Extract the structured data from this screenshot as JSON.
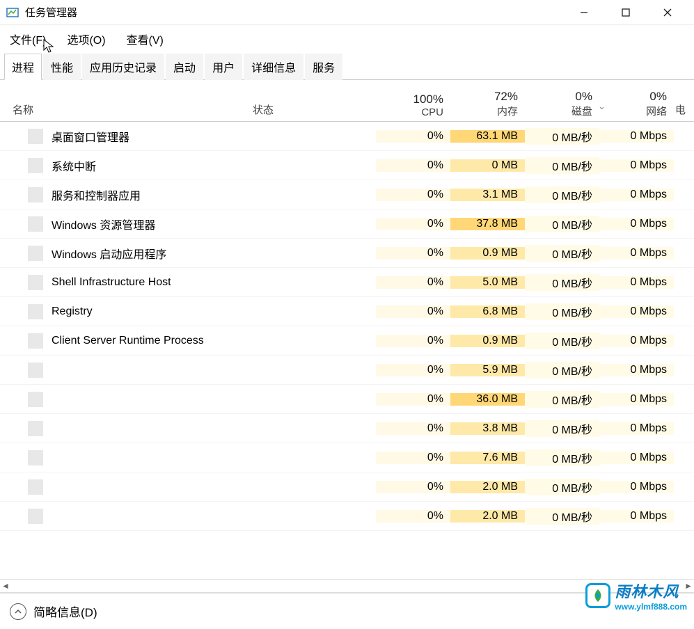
{
  "window": {
    "title": "任务管理器"
  },
  "menu": {
    "file": "文件(F)",
    "options": "选项(O)",
    "view": "查看(V)"
  },
  "tabs": {
    "processes": "进程",
    "performance": "性能",
    "appHistory": "应用历史记录",
    "startup": "启动",
    "users": "用户",
    "details": "详细信息",
    "services": "服务"
  },
  "columns": {
    "name": "名称",
    "status": "状态",
    "cpu_pct": "100%",
    "cpu_label": "CPU",
    "mem_pct": "72%",
    "mem_label": "内存",
    "disk_pct": "0%",
    "disk_label": "磁盘",
    "net_pct": "0%",
    "net_label": "网络",
    "edge_label": "电"
  },
  "processes": [
    {
      "name": "桌面窗口管理器",
      "cpu": "0%",
      "mem": "63.1 MB",
      "mem_heat": "heat-mem1",
      "disk": "0 MB/秒",
      "net": "0 Mbps"
    },
    {
      "name": "系统中断",
      "cpu": "0%",
      "mem": "0 MB",
      "mem_heat": "heat-mem2",
      "disk": "0 MB/秒",
      "net": "0 Mbps"
    },
    {
      "name": "服务和控制器应用",
      "cpu": "0%",
      "mem": "3.1 MB",
      "mem_heat": "heat-mem0",
      "disk": "0 MB/秒",
      "net": "0 Mbps"
    },
    {
      "name": "Windows 资源管理器",
      "cpu": "0%",
      "mem": "37.8 MB",
      "mem_heat": "heat-mem1",
      "disk": "0 MB/秒",
      "net": "0 Mbps"
    },
    {
      "name": "Windows 启动应用程序",
      "cpu": "0%",
      "mem": "0.9 MB",
      "mem_heat": "heat-mem0",
      "disk": "0 MB/秒",
      "net": "0 Mbps"
    },
    {
      "name": "Shell Infrastructure Host",
      "cpu": "0%",
      "mem": "5.0 MB",
      "mem_heat": "heat-mem0",
      "disk": "0 MB/秒",
      "net": "0 Mbps"
    },
    {
      "name": "Registry",
      "cpu": "0%",
      "mem": "6.8 MB",
      "mem_heat": "heat-mem0",
      "disk": "0 MB/秒",
      "net": "0 Mbps"
    },
    {
      "name": "Client Server Runtime Process",
      "cpu": "0%",
      "mem": "0.9 MB",
      "mem_heat": "heat-mem0",
      "disk": "0 MB/秒",
      "net": "0 Mbps"
    },
    {
      "name": "",
      "cpu": "0%",
      "mem": "5.9 MB",
      "mem_heat": "heat-mem0",
      "disk": "0 MB/秒",
      "net": "0 Mbps"
    },
    {
      "name": "",
      "cpu": "0%",
      "mem": "36.0 MB",
      "mem_heat": "heat-mem1",
      "disk": "0 MB/秒",
      "net": "0 Mbps"
    },
    {
      "name": "",
      "cpu": "0%",
      "mem": "3.8 MB",
      "mem_heat": "heat-mem0",
      "disk": "0 MB/秒",
      "net": "0 Mbps"
    },
    {
      "name": "",
      "cpu": "0%",
      "mem": "7.6 MB",
      "mem_heat": "heat-mem0",
      "disk": "0 MB/秒",
      "net": "0 Mbps"
    },
    {
      "name": "",
      "cpu": "0%",
      "mem": "2.0 MB",
      "mem_heat": "heat-mem0",
      "disk": "0 MB/秒",
      "net": "0 Mbps"
    },
    {
      "name": "",
      "cpu": "0%",
      "mem": "2.0 MB",
      "mem_heat": "heat-mem0",
      "disk": "0 MB/秒",
      "net": "0 Mbps"
    }
  ],
  "footer": {
    "fewer_details": "简略信息(D)"
  },
  "watermark": {
    "text": "雨林木风",
    "url": "www.ylmf888.com"
  }
}
